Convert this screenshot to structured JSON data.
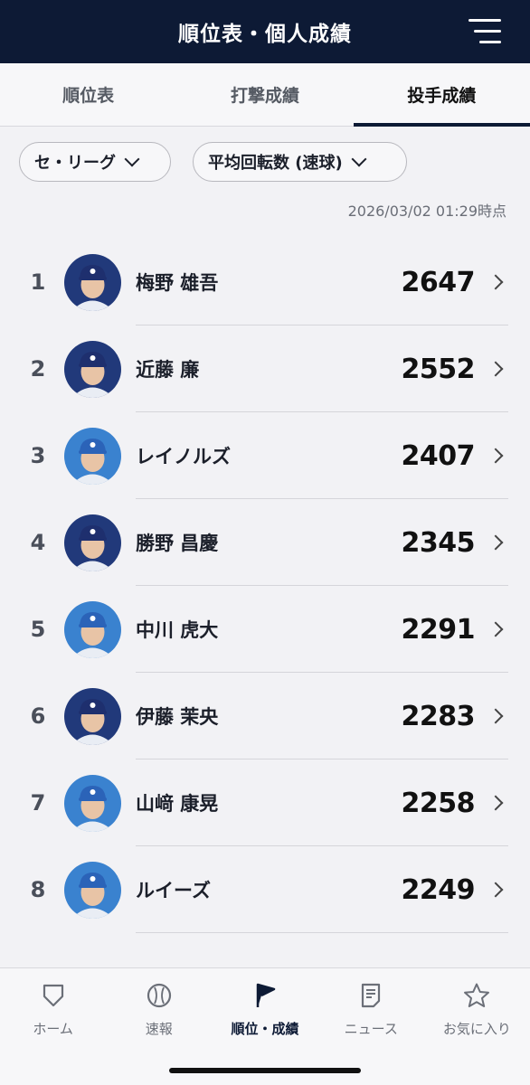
{
  "header": {
    "title": "順位表・個人成績"
  },
  "tabs": [
    {
      "label": "順位表",
      "active": false
    },
    {
      "label": "打撃成績",
      "active": false
    },
    {
      "label": "投手成績",
      "active": true
    }
  ],
  "filters": {
    "league": "セ・リーグ",
    "metric": "平均回転数 (速球)"
  },
  "timestamp": "2026/03/02 01:29時点",
  "players": [
    {
      "rank": "1",
      "name": "梅野 雄吾",
      "value": "2647",
      "cap": "navy"
    },
    {
      "rank": "2",
      "name": "近藤 廉",
      "value": "2552",
      "cap": "navy"
    },
    {
      "rank": "3",
      "name": "レイノルズ",
      "value": "2407",
      "cap": "blue"
    },
    {
      "rank": "4",
      "name": "勝野 昌慶",
      "value": "2345",
      "cap": "navy"
    },
    {
      "rank": "5",
      "name": "中川 虎大",
      "value": "2291",
      "cap": "blue"
    },
    {
      "rank": "6",
      "name": "伊藤 茉央",
      "value": "2283",
      "cap": "navy"
    },
    {
      "rank": "7",
      "name": "山﨑 康晃",
      "value": "2258",
      "cap": "blue"
    },
    {
      "rank": "8",
      "name": "ルイーズ",
      "value": "2249",
      "cap": "blue"
    }
  ],
  "bottom_nav": [
    {
      "label": "ホーム",
      "icon": "home-plate-icon",
      "active": false
    },
    {
      "label": "速報",
      "icon": "baseball-icon",
      "active": false
    },
    {
      "label": "順位・成績",
      "icon": "flag-icon",
      "active": true
    },
    {
      "label": "ニュース",
      "icon": "news-icon",
      "active": false
    },
    {
      "label": "お気に入り",
      "icon": "star-icon",
      "active": false
    }
  ],
  "colors": {
    "header_bg": "#0d1a35",
    "background": "#f2f2f5",
    "cap_navy": "#1e2f6e",
    "cap_blue": "#2b63b8"
  }
}
